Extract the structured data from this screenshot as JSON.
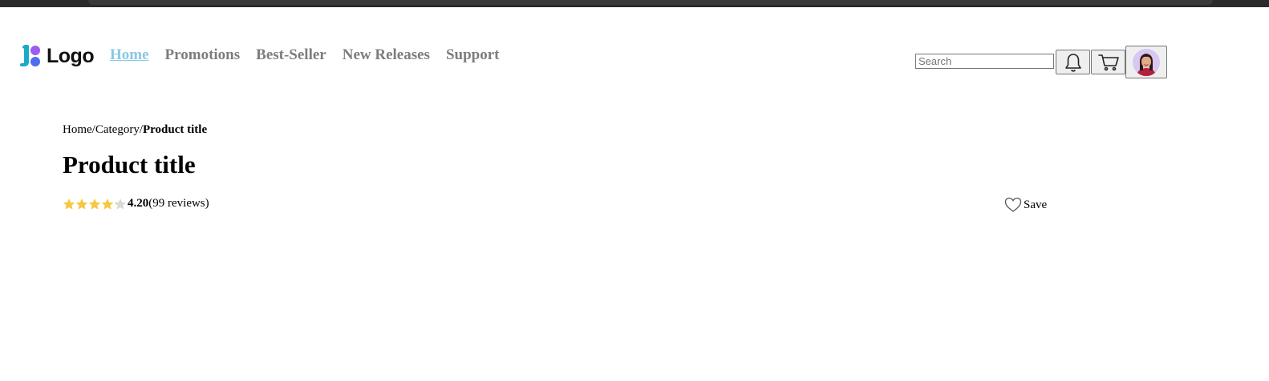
{
  "header": {
    "logo_text": "Logo",
    "nav": [
      {
        "label": "Home",
        "active": true
      },
      {
        "label": "Promotions"
      },
      {
        "label": "Best-Seller"
      },
      {
        "label": "New Releases"
      },
      {
        "label": "Support"
      }
    ],
    "search": {
      "placeholder": "Search",
      "value": ""
    },
    "icons": {
      "notifications": "bell-icon",
      "cart": "cart-icon",
      "avatar": "user-avatar"
    }
  },
  "breadcrumb": {
    "items": [
      "Home",
      "Category"
    ],
    "separator": "/",
    "current": "Product title"
  },
  "product": {
    "title": "Product title",
    "rating": 4.2,
    "rating_label": "4.20",
    "max_rating": 5,
    "reviews_label": "(99 reviews)",
    "save_label": "Save"
  },
  "colors": {
    "star": "#f5c842",
    "star_empty": "#d9d9d9",
    "nav_active": "#86c8e6",
    "nav_inactive": "#7d7d7d",
    "logo_teal": "#1ba9c8",
    "logo_purple": "#9b5cf0",
    "logo_blue": "#4d6ff0"
  }
}
